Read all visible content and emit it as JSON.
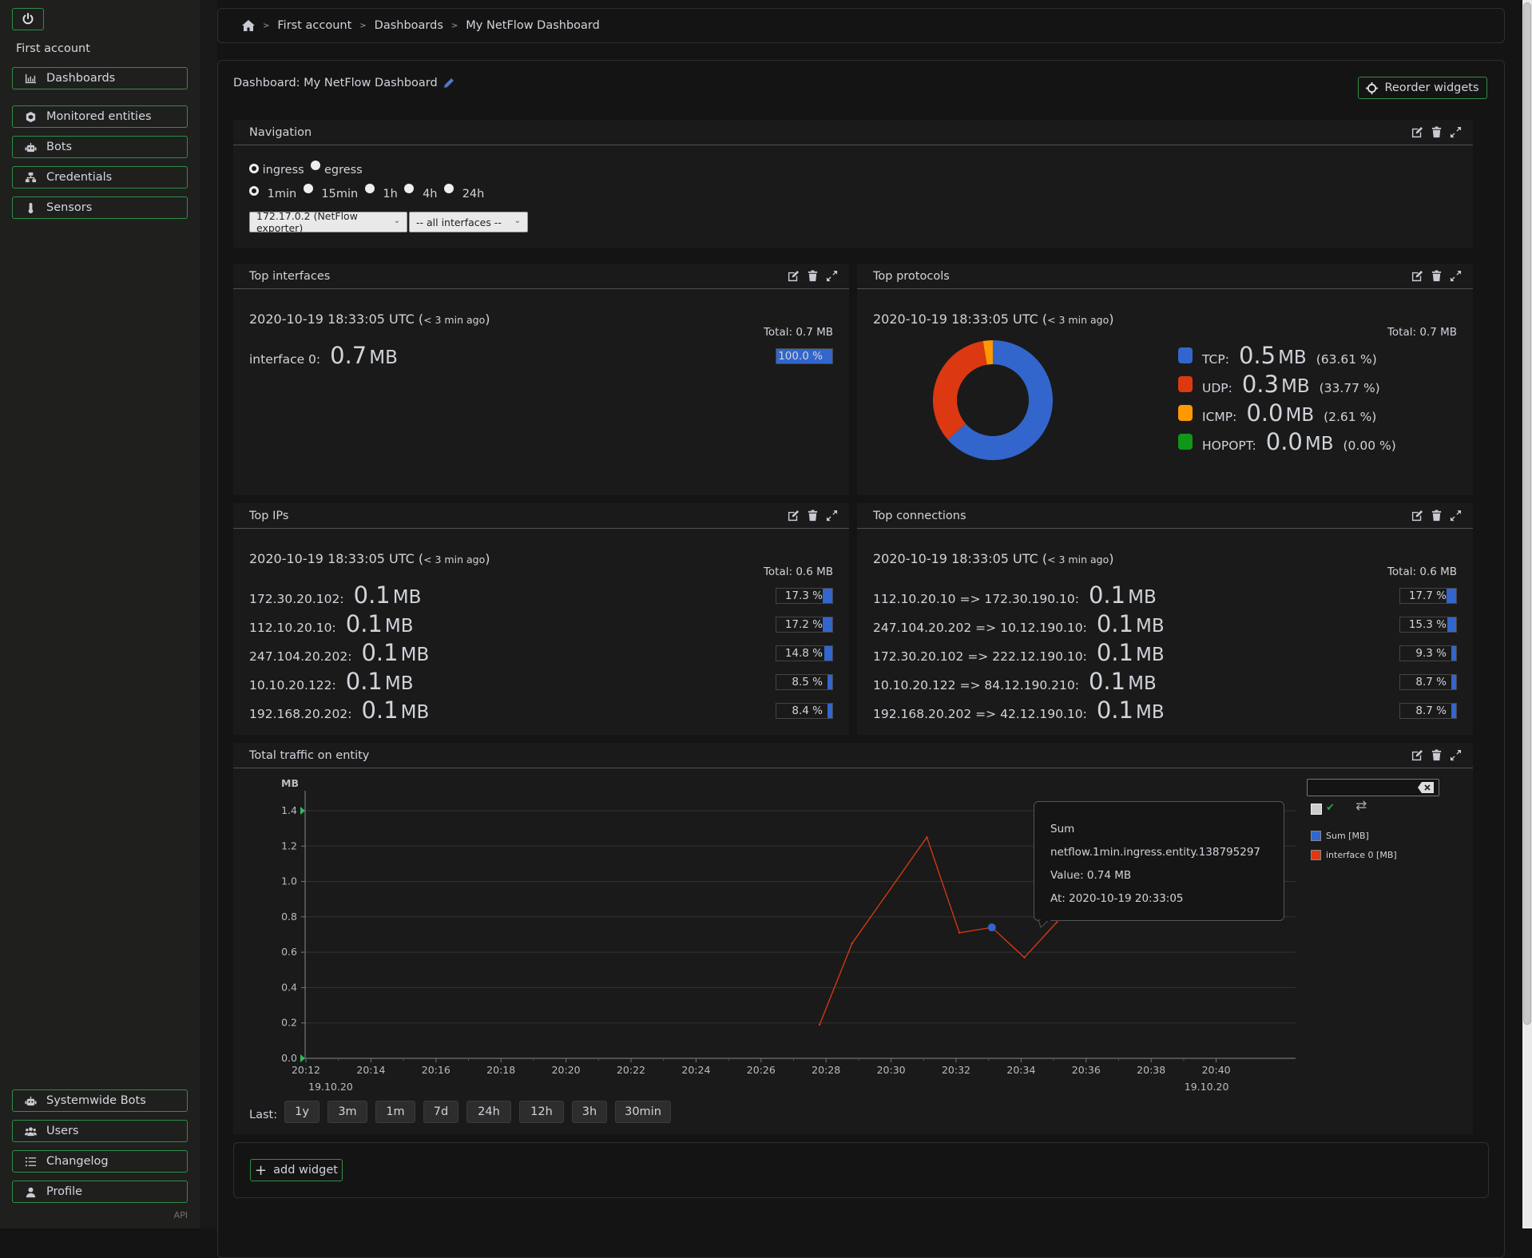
{
  "sidebar": {
    "account": "First account",
    "top_items": [
      {
        "label": "Dashboards",
        "icon": "chart-icon"
      },
      {
        "label": "Monitored entities",
        "icon": "cube-icon"
      },
      {
        "label": "Bots",
        "icon": "robot-icon"
      },
      {
        "label": "Credentials",
        "icon": "network-icon"
      },
      {
        "label": "Sensors",
        "icon": "thermometer-icon"
      }
    ],
    "bottom_items": [
      {
        "label": "Systemwide Bots",
        "icon": "robot-icon"
      },
      {
        "label": "Users",
        "icon": "users-icon"
      },
      {
        "label": "Changelog",
        "icon": "list-icon"
      },
      {
        "label": "Profile",
        "icon": "user-icon"
      }
    ],
    "api_label": "API"
  },
  "breadcrumb": [
    "First account",
    "Dashboards",
    "My NetFlow Dashboard"
  ],
  "dashboard": {
    "title": "Dashboard: My NetFlow Dashboard",
    "reorder_label": "Reorder widgets",
    "add_widget_label": "add widget"
  },
  "navigation": {
    "title": "Navigation",
    "direction": [
      {
        "label": "ingress",
        "checked": true
      },
      {
        "label": "egress",
        "checked": false
      }
    ],
    "intervals": [
      {
        "label": "1min",
        "checked": true
      },
      {
        "label": "15min",
        "checked": false
      },
      {
        "label": "1h",
        "checked": false
      },
      {
        "label": "4h",
        "checked": false
      },
      {
        "label": "24h",
        "checked": false
      }
    ],
    "exporter_select": "172.17.0.2 (NetFlow exporter)",
    "interface_select": "-- all interfaces --"
  },
  "top_interfaces": {
    "title": "Top interfaces",
    "timestamp": "2020-10-19 18:33:05 UTC",
    "ago": "< 3 min ago",
    "total": "Total: 0.7 MB",
    "rows": [
      {
        "label": "interface 0:",
        "value": "0.7",
        "unit": "MB",
        "percent": "100.0 %",
        "fraction": 1.0
      }
    ]
  },
  "top_protocols": {
    "title": "Top protocols",
    "timestamp": "2020-10-19 18:33:05 UTC",
    "ago": "< 3 min ago",
    "total": "Total: 0.7 MB",
    "rows": [
      {
        "label": "TCP:",
        "value": "0.5",
        "unit": "MB",
        "percent": "(63.61 %)",
        "share": 63.61,
        "color": "#3366cc"
      },
      {
        "label": "UDP:",
        "value": "0.3",
        "unit": "MB",
        "percent": "(33.77 %)",
        "share": 33.77,
        "color": "#dc3912"
      },
      {
        "label": "ICMP:",
        "value": "0.0",
        "unit": "MB",
        "percent": "(2.61 %)",
        "share": 2.61,
        "color": "#ff9900"
      },
      {
        "label": "HOPOPT:",
        "value": "0.0",
        "unit": "MB",
        "percent": "(0.00 %)",
        "share": 0.0,
        "color": "#109618"
      }
    ]
  },
  "top_ips": {
    "title": "Top IPs",
    "timestamp": "2020-10-19 18:33:05 UTC",
    "ago": "< 3 min ago",
    "total": "Total: 0.6 MB",
    "rows": [
      {
        "label": "172.30.20.102:",
        "value": "0.1",
        "unit": "MB",
        "percent": "17.3 %",
        "fraction": 0.173
      },
      {
        "label": "112.10.20.10:",
        "value": "0.1",
        "unit": "MB",
        "percent": "17.2 %",
        "fraction": 0.172
      },
      {
        "label": "247.104.20.202:",
        "value": "0.1",
        "unit": "MB",
        "percent": "14.8 %",
        "fraction": 0.148
      },
      {
        "label": "10.10.20.122:",
        "value": "0.1",
        "unit": "MB",
        "percent": "8.5 %",
        "fraction": 0.085
      },
      {
        "label": "192.168.20.202:",
        "value": "0.1",
        "unit": "MB",
        "percent": "8.4 %",
        "fraction": 0.084
      }
    ]
  },
  "top_connections": {
    "title": "Top connections",
    "timestamp": "2020-10-19 18:33:05 UTC",
    "ago": "< 3 min ago",
    "total": "Total: 0.6 MB",
    "rows": [
      {
        "label": "112.10.20.10 => 172.30.190.10:",
        "value": "0.1",
        "unit": "MB",
        "percent": "17.7 %",
        "fraction": 0.177
      },
      {
        "label": "247.104.20.202 => 10.12.190.10:",
        "value": "0.1",
        "unit": "MB",
        "percent": "15.3 %",
        "fraction": 0.153
      },
      {
        "label": "172.30.20.102 => 222.12.190.10:",
        "value": "0.1",
        "unit": "MB",
        "percent": "9.3 %",
        "fraction": 0.093
      },
      {
        "label": "10.10.20.122 => 84.12.190.210:",
        "value": "0.1",
        "unit": "MB",
        "percent": "8.7 %",
        "fraction": 0.087
      },
      {
        "label": "192.168.20.202 => 42.12.190.10:",
        "value": "0.1",
        "unit": "MB",
        "percent": "8.7 %",
        "fraction": 0.087
      }
    ]
  },
  "traffic": {
    "title": "Total traffic on entity",
    "last_label": "Last:",
    "ranges": [
      "1y",
      "3m",
      "1m",
      "7d",
      "24h",
      "12h",
      "3h",
      "30min"
    ],
    "legend": [
      {
        "label": "Sum [MB]",
        "color": "#3366cc"
      },
      {
        "label": "interface 0 [MB]",
        "color": "#dc3912"
      }
    ],
    "tooltip": {
      "series": "Sum",
      "path": "netflow.1min.ingress.entity.138795297",
      "value": "Value: 0.74 MB",
      "at": "At: 2020-10-19 20:33:05"
    }
  },
  "chart_data": {
    "type": "line",
    "title": "Total traffic on entity",
    "xlabel": "",
    "ylabel": "MB",
    "ylim": [
      0,
      1.4
    ],
    "xlim_minutes": [
      12,
      40
    ],
    "x_ticks": [
      "20:12",
      "20:14",
      "20:16",
      "20:18",
      "20:20",
      "20:22",
      "20:24",
      "20:26",
      "20:28",
      "20:30",
      "20:32",
      "20:34",
      "20:36",
      "20:38",
      "20:40"
    ],
    "y_ticks": [
      "0.0",
      "0.2",
      "0.4",
      "0.6",
      "0.8",
      "1.0",
      "1.2",
      "1.4"
    ],
    "date_left": "19.10.20",
    "date_right": "19.10.20",
    "grid": true,
    "legend_position": "right",
    "series": [
      {
        "name": "interface 0 [MB]",
        "color": "#dc3912",
        "x": [
          "20:27:48",
          "20:28:48",
          "20:31:05",
          "20:32:05",
          "20:33:05",
          "20:34:05",
          "20:35:05"
        ],
        "x_minutes": [
          27.8,
          28.8,
          31.1,
          32.1,
          33.1,
          34.1,
          35.1
        ],
        "values": [
          0.19,
          0.65,
          1.25,
          0.71,
          0.74,
          0.57,
          0.77
        ]
      },
      {
        "name": "Sum [MB]",
        "color": "#3366cc",
        "x": [
          "20:33:05"
        ],
        "x_minutes": [
          33.1
        ],
        "values": [
          0.74
        ],
        "highlighted": true
      }
    ]
  }
}
